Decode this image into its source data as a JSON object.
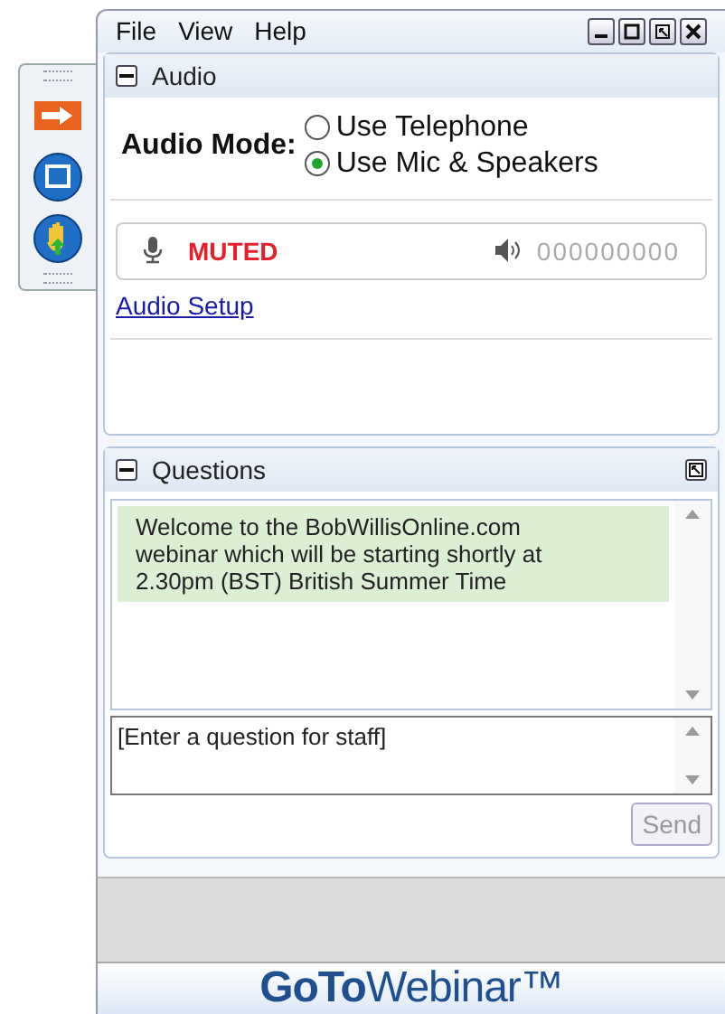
{
  "menu": [
    "File",
    "View",
    "Help"
  ],
  "audio": {
    "title": "Audio",
    "mode_label": "Audio Mode:",
    "options": [
      {
        "label": "Use Telephone",
        "selected": false
      },
      {
        "label": "Use Mic & Speakers",
        "selected": true
      }
    ],
    "mic_status": "MUTED",
    "pin": "000000000",
    "setup_link": "Audio Setup"
  },
  "questions": {
    "title": "Questions",
    "messages": [
      "Welcome to the BobWillisOnline.com webinar which will be starting shortly at 2.30pm (BST) British Summer Time"
    ],
    "input": {
      "placeholder": "[Enter a question for staff]"
    },
    "send": {
      "label": "Send",
      "disabled": true
    }
  },
  "logo": "**GoTo**Webinar™"
}
